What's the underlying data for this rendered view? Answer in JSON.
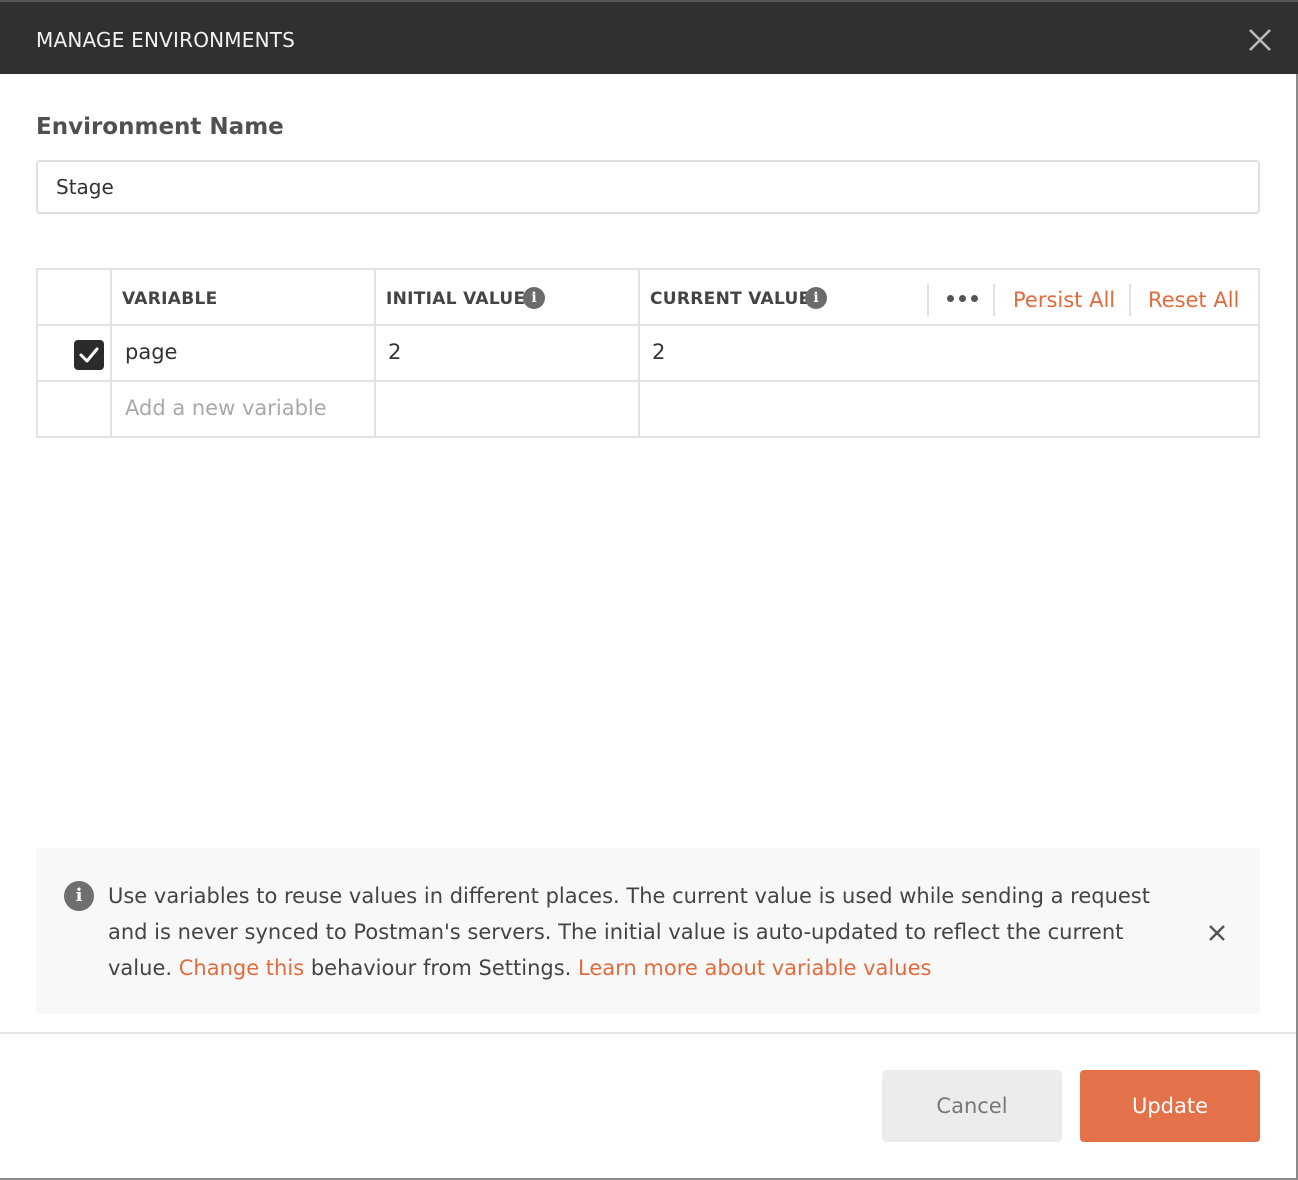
{
  "dialog": {
    "title": "MANAGE ENVIRONMENTS",
    "close_icon": "close-icon"
  },
  "environment": {
    "label": "Environment Name",
    "value": "Stage"
  },
  "table": {
    "headers": {
      "variable": "VARIABLE",
      "initial_value": "INITIAL VALUE",
      "current_value": "CURRENT VALUE"
    },
    "info_icon": "info-icon",
    "more_icon": "more-horizontal-icon",
    "persist_all": "Persist All",
    "reset_all": "Reset All",
    "rows": [
      {
        "enabled": true,
        "variable": "page",
        "initial_value": "2",
        "current_value": "2"
      }
    ],
    "new_variable_placeholder": "Add a new variable"
  },
  "info_banner": {
    "text": "Use variables to reuse values in different places. The current value is used while sending a request and is never synced to Postman's servers. The initial value is auto-updated to reflect the current value.",
    "link_change": "Change this",
    "text_after": "behaviour from Settings.",
    "link_learn": "Learn more about variable values",
    "dismiss_icon": "close-icon"
  },
  "footer": {
    "cancel_label": "Cancel",
    "update_label": "Update"
  },
  "colors": {
    "accent": "#e3714a",
    "link": "#e26b3d",
    "title_bar": "#303030"
  }
}
